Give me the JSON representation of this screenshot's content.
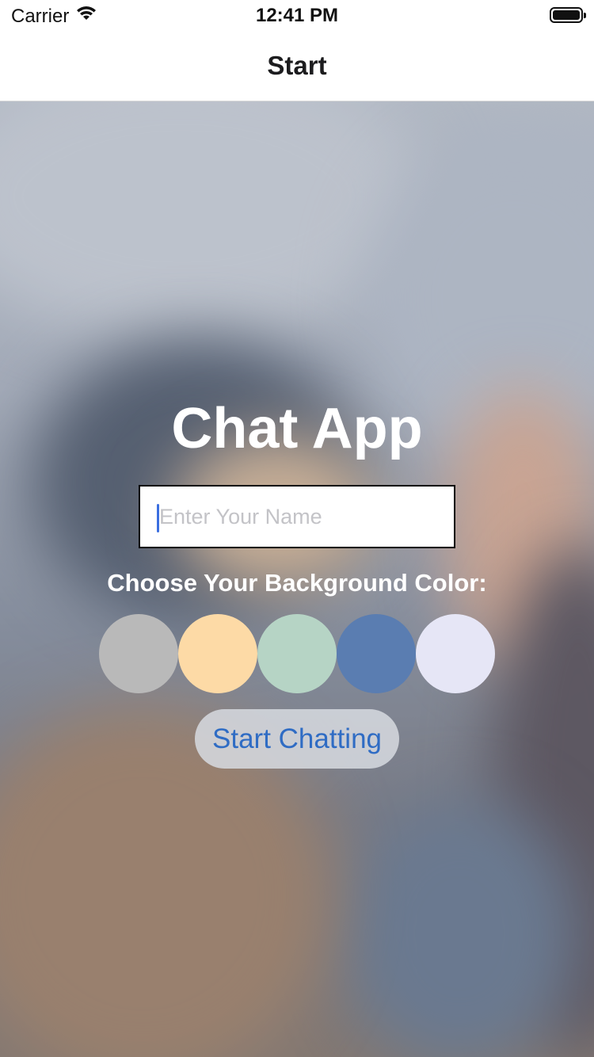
{
  "status_bar": {
    "carrier": "Carrier",
    "time": "12:41 PM",
    "wifi_icon": "wifi-icon",
    "battery_icon": "battery-icon"
  },
  "nav": {
    "title": "Start"
  },
  "main": {
    "app_title": "Chat App",
    "name_input": {
      "value": "",
      "placeholder": "Enter Your Name"
    },
    "color_label": "Choose Your Background Color:",
    "color_options": [
      "#b9b9b9",
      "#fddaa6",
      "#b6d4c5",
      "#5a7db1",
      "#e6e6f6"
    ],
    "start_button_label": "Start Chatting"
  },
  "colors": {
    "button_text": "#2f6cc4",
    "caret": "#3b6fe0"
  }
}
